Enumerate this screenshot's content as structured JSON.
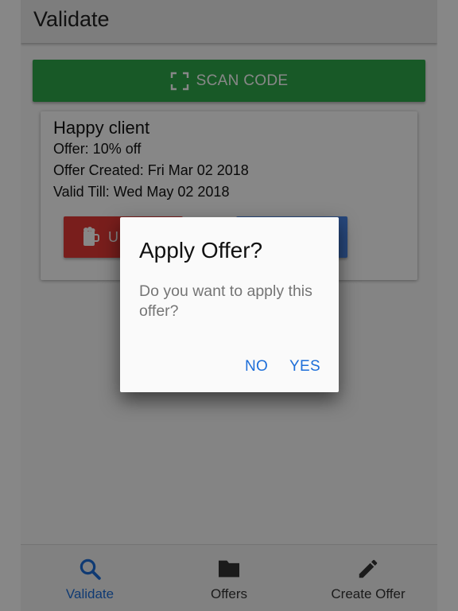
{
  "app_bar": {
    "title": "Validate"
  },
  "scan_button": {
    "label": "SCAN CODE",
    "icon": "scan-frame-icon",
    "color": "#2fa84a"
  },
  "offer_card": {
    "title": "Happy client",
    "offer": "Offer: 10% off",
    "created": "Offer Created: Fri Mar 02 2018",
    "valid_till": "Valid Till: Wed May 02 2018",
    "use_button": {
      "label": "U",
      "icon": "mug-icon",
      "color": "#e53935"
    },
    "second_button": {
      "color": "#4a86e8"
    }
  },
  "dialog": {
    "title": "Apply Offer?",
    "message": "Do you want to apply this offer?",
    "no_label": "NO",
    "yes_label": "YES"
  },
  "bottom_nav": {
    "items": [
      {
        "label": "Validate",
        "icon": "search-icon",
        "active": true
      },
      {
        "label": "Offers",
        "icon": "folder-icon",
        "active": false
      },
      {
        "label": "Create Offer",
        "icon": "pencil-icon",
        "active": false
      }
    ],
    "active_color": "#1e6fd9"
  }
}
